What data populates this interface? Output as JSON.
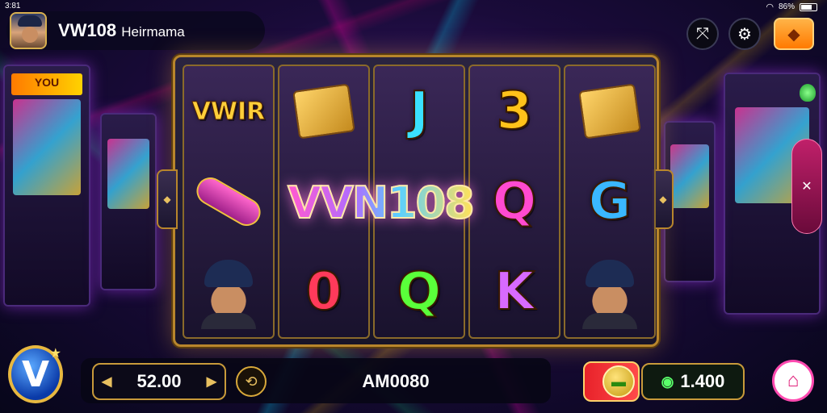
{
  "status_bar": {
    "time": "3:81",
    "battery": "86%"
  },
  "player": {
    "name": "VW108",
    "subtitle": "Heirmama"
  },
  "reels": [
    [
      {
        "type": "text",
        "text": "VWIR",
        "color": "#ffcf3a"
      },
      {
        "type": "scroll",
        "name": "scroll-symbol"
      },
      {
        "type": "face",
        "name": "hero-face-symbol"
      }
    ],
    [
      {
        "type": "ticket",
        "name": "ticket-box-symbol"
      },
      {
        "type": "wild"
      },
      {
        "type": "text",
        "text": "0",
        "color": "#ff3a5a"
      }
    ],
    [
      {
        "type": "text",
        "text": "J",
        "color": "#3ae0ff"
      },
      {
        "type": "wild"
      },
      {
        "type": "text",
        "text": "Q",
        "color": "#5aff3a"
      }
    ],
    [
      {
        "type": "text",
        "text": "3",
        "color": "#ffc21a"
      },
      {
        "type": "text",
        "text": "Q",
        "color": "#ff4ad0"
      },
      {
        "type": "text",
        "text": "K",
        "color": "#d86aff"
      }
    ],
    [
      {
        "type": "ticket",
        "name": "ticket-box-symbol"
      },
      {
        "type": "text",
        "text": "G",
        "color": "#3ab8ff"
      },
      {
        "type": "face",
        "name": "hero-face-symbol"
      }
    ]
  ],
  "wild_banner": "VVN108",
  "arcade_marquee": "YOU",
  "bottom": {
    "bet": "52.00",
    "win_label": "AM0080",
    "balance": "1.400"
  },
  "logo": "V",
  "colors": {
    "gold": "#c89a3a",
    "accent_pink": "#ff4ab0",
    "spin_red": "#e8222a"
  }
}
